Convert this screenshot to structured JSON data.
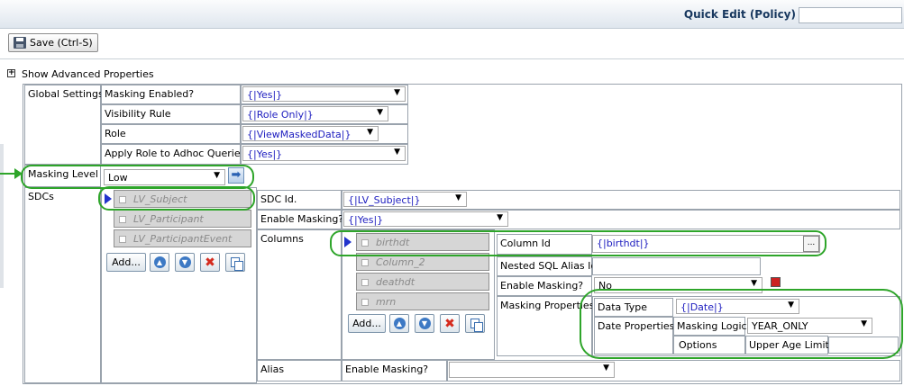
{
  "header": {
    "title": "Quick Edit (Policy)",
    "search_value": ""
  },
  "toolbar": {
    "save_label": "Save (Ctrl-S)"
  },
  "advanced": {
    "toggle_symbol": "+",
    "label": "Show Advanced Properties"
  },
  "global": {
    "label": "Global Settings",
    "rows": [
      {
        "label": "Masking Enabled?",
        "value": "{|Yes|}"
      },
      {
        "label": "Visibility Rule",
        "value": "{|Role Only|}"
      },
      {
        "label": "Role",
        "value": "{|ViewMaskedData|}"
      },
      {
        "label": "Apply Role to Adhoc Queries",
        "value": "{|Yes|}"
      }
    ]
  },
  "masking_level": {
    "label": "Masking Level",
    "value": "Low"
  },
  "sdcs": {
    "label": "SDCs",
    "items": [
      "LV_Subject",
      "LV_Participant",
      "LV_ParticipantEvent"
    ],
    "add_label": "Add...",
    "sdc_id_label": "SDC Id.",
    "sdc_id_value": "{|LV_Subject|}",
    "enable_masking_label": "Enable Masking?",
    "enable_masking_value": "{|Yes|}",
    "columns_label": "Columns",
    "alias_label": "Alias",
    "alias_enable_label": "Enable Masking?",
    "alias_enable_value": ""
  },
  "columns": {
    "items": [
      "birthdt",
      "Column_2",
      "deathdt",
      "mrn"
    ],
    "add_label": "Add...",
    "column_id_label": "Column Id",
    "column_id_value": "{|birthdt|}",
    "ellipsis": "...",
    "nested_label": "Nested SQL Alias Id",
    "nested_value": "",
    "enable_label": "Enable Masking?",
    "enable_value": "No",
    "props_label": "Masking Properties",
    "data_type_label": "Data Type",
    "data_type_value": "{|Date|}",
    "date_props_label": "Date Properties",
    "logic_label": "Masking Logic",
    "logic_value": "YEAR_ONLY",
    "options_label": "Options",
    "upper_label": "Upper Age Limit",
    "upper_value": ""
  },
  "colors": {
    "accent": "#2ea52a",
    "link": "#2020c0",
    "header_text": "#17375e"
  }
}
